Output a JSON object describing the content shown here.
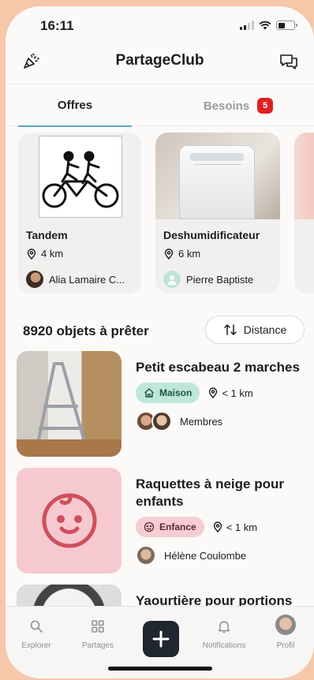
{
  "status_bar": {
    "time": "16:11"
  },
  "header": {
    "title": "PartageClub",
    "left_icon": "party-popper-icon",
    "right_icon": "chat-bubbles-icon"
  },
  "tabs": [
    {
      "label": "Offres",
      "active": true
    },
    {
      "label": "Besoins",
      "badge": "5",
      "active": false
    }
  ],
  "featured": [
    {
      "title": "Tandem",
      "distance": "4 km",
      "user": "Alia Lamaire C..."
    },
    {
      "title": "Deshumidificateur",
      "distance": "6 km",
      "user": "Pierre Baptiste"
    }
  ],
  "list": {
    "count": "8920 objets à prêter",
    "sort_label": "Distance",
    "items": [
      {
        "title": "Petit escabeau 2 marches",
        "category": "Maison",
        "distance": "< 1 km",
        "owner": "Membres"
      },
      {
        "title": "Raquettes à neige pour enfants",
        "category": "Enfance",
        "distance": "< 1 km",
        "owner": "Hélène Coulombe"
      },
      {
        "title": "Yaourtière pour portions"
      }
    ]
  },
  "bottom_nav": {
    "explorer": "Explorer",
    "partages": "Partages",
    "notifications": "Notifications",
    "profil": "Profil"
  },
  "colors": {
    "accent": "#5aa3c8",
    "badge": "#e02121",
    "maison_tag": "#bfe6da",
    "enfance_tag": "#f5cdd3",
    "background": "#f6c7a9"
  }
}
